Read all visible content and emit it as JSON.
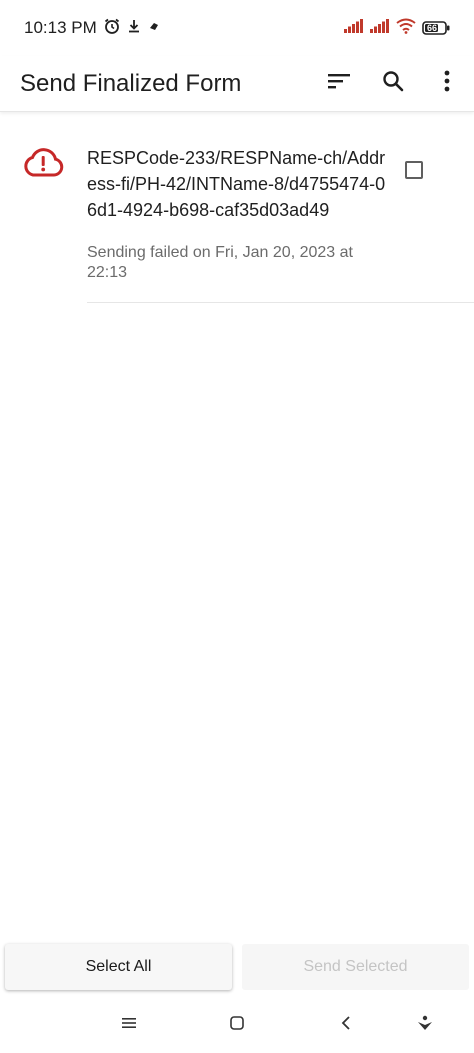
{
  "status_bar": {
    "time": "10:13 PM",
    "icons": [
      "alarm-icon",
      "download-icon",
      "notification-icon",
      "signal-icon",
      "signal-icon",
      "wifi-icon",
      "battery-icon"
    ],
    "battery_level": "66",
    "signal_color": "#c0392b"
  },
  "app_bar": {
    "title": "Send Finalized Form",
    "actions": [
      "sort-icon",
      "search-icon",
      "more-vert-icon"
    ]
  },
  "forms": [
    {
      "title": "RESPCode-233/RESPName-ch/Address-fi/PH-42/INTName-8/d4755474-06d1-4924-b698-caf35d03ad49",
      "subtitle": "Sending failed on Fri, Jan 20, 2023 at 22:13",
      "status_icon": "cloud-error-icon",
      "status_color": "#c62828",
      "checked": false
    }
  ],
  "buttons": {
    "select_all": "Select All",
    "send_selected": "Send Selected"
  },
  "nav_bar": {
    "icons": [
      "menu-icon",
      "home-icon",
      "back-icon",
      "assistant-icon"
    ]
  }
}
